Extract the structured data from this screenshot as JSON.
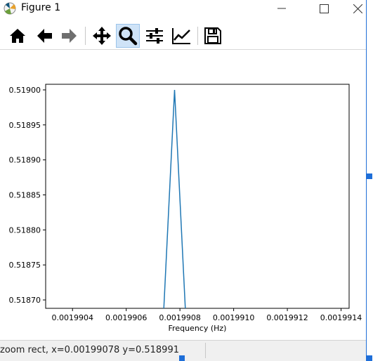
{
  "window": {
    "title": "Figure 1",
    "minimize_glyph": "—",
    "maximize_glyph": "☐",
    "close_glyph": "✕"
  },
  "toolbar": {
    "buttons": [
      {
        "name": "home",
        "icon": "home-icon",
        "tooltip": "Reset original view"
      },
      {
        "name": "back",
        "icon": "arrow-left-icon",
        "tooltip": "Back to previous view"
      },
      {
        "name": "forward",
        "icon": "arrow-right-icon",
        "tooltip": "Forward to next view"
      },
      {
        "name": "pan",
        "icon": "move-icon",
        "tooltip": "Pan axes"
      },
      {
        "name": "zoom",
        "icon": "magnifier-icon",
        "tooltip": "Zoom to rectangle",
        "active": true
      },
      {
        "name": "subplots",
        "icon": "sliders-icon",
        "tooltip": "Configure subplots"
      },
      {
        "name": "edit",
        "icon": "line-chart-icon",
        "tooltip": "Edit axis, curve and image parameters"
      },
      {
        "name": "save",
        "icon": "floppy-icon",
        "tooltip": "Save the figure"
      }
    ]
  },
  "status": {
    "text": "zoom rect, x=0.00199078   y=0.518991"
  },
  "colors": {
    "line": "#1f77b4",
    "active_button": "#cfe3f7",
    "selection_handle": "#1e6ed8"
  },
  "chart_data": {
    "type": "line",
    "title": "",
    "xlabel": "Frequency (Hz)",
    "ylabel": "",
    "xlim": [
      0.0019903,
      0.00199143
    ],
    "ylim": [
      0.518688,
      0.519008
    ],
    "xticks": [
      0.0019904,
      0.0019906,
      0.0019908,
      0.001991,
      0.0019912,
      0.0019914
    ],
    "xtick_labels": [
      "0.0019904",
      "0.0019906",
      "0.0019908",
      "0.0019910",
      "0.0019912",
      "0.0019914"
    ],
    "yticks": [
      0.5187,
      0.51875,
      0.5188,
      0.51885,
      0.5189,
      0.51895,
      0.519
    ],
    "ytick_labels": [
      "0.51870",
      "0.51875",
      "0.51880",
      "0.51885",
      "0.51890",
      "0.51895",
      "0.51900"
    ],
    "grid": false,
    "series": [
      {
        "x": [
          0.00199074,
          0.00199078,
          0.00199082
        ],
        "y": [
          0.518688,
          0.519,
          0.518688
        ]
      }
    ]
  }
}
